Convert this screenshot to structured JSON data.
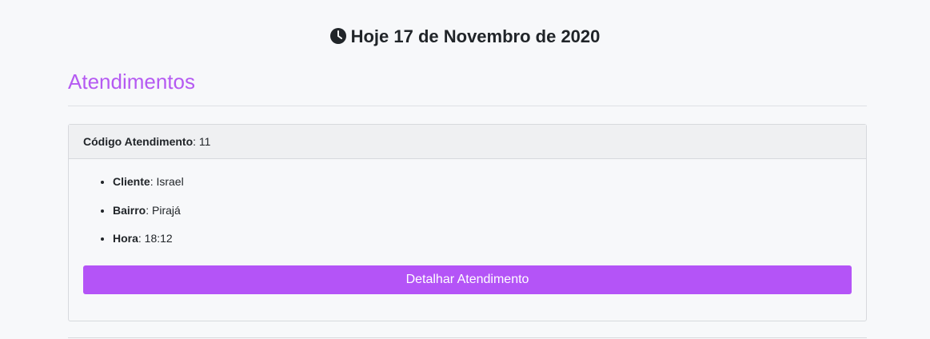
{
  "header": {
    "icon": "clock-icon",
    "date_text": "Hoje 17 de Novembro de 2020"
  },
  "section": {
    "title": "Atendimentos",
    "accent_color": "#b55af2"
  },
  "appointments": [
    {
      "code_label": "Código Atendimento",
      "code_value": ": 11",
      "fields": [
        {
          "label": "Cliente",
          "value": ": Israel"
        },
        {
          "label": "Bairro",
          "value": ": Pirajá"
        },
        {
          "label": "Hora",
          "value": ": 18:12"
        }
      ],
      "button_label": "Detalhar Atendimento",
      "button_color": "#b454f7"
    }
  ]
}
